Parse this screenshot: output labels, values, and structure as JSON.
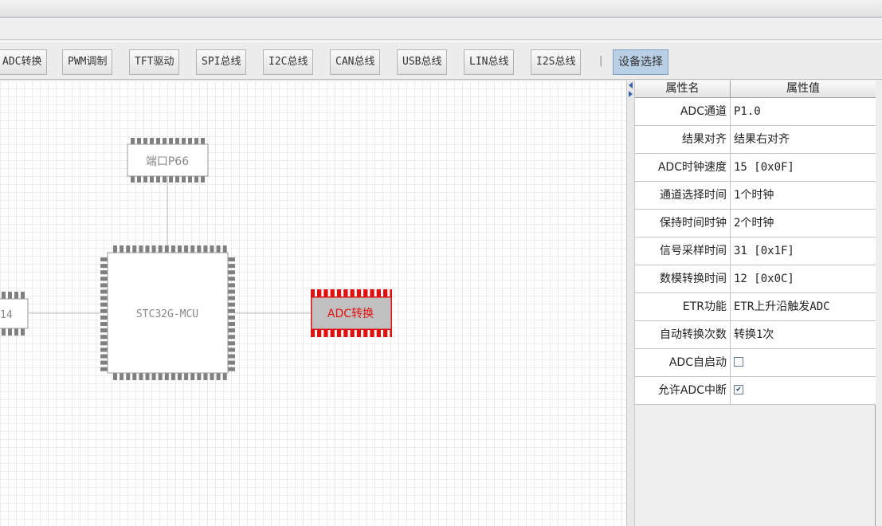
{
  "toolbar": {
    "buttons": [
      "ADC转换",
      "PWM调制",
      "TFT驱动",
      "SPI总线",
      "I2C总线",
      "CAN总线",
      "USB总线",
      "LIN总线",
      "I2S总线"
    ],
    "separator": "|",
    "active_button": "设备选择"
  },
  "canvas": {
    "port_chip": "端口P66",
    "mcu_chip": "STC32G-MCU",
    "adc_chip": "ADC转换",
    "left_chip_partial": "14"
  },
  "properties": {
    "header_name": "属性名",
    "header_value": "属性值",
    "rows": [
      {
        "name": "ADC通道",
        "value": "P1.0"
      },
      {
        "name": "结果对齐",
        "value": "结果右对齐"
      },
      {
        "name": "ADC时钟速度",
        "value": "15 [0x0F]"
      },
      {
        "name": "通道选择时间",
        "value": "1个时钟"
      },
      {
        "name": "保持时间时钟",
        "value": "2个时钟"
      },
      {
        "name": "信号采样时间",
        "value": "31 [0x1F]"
      },
      {
        "name": "数模转换时间",
        "value": "12 [0x0C]"
      },
      {
        "name": "ETR功能",
        "value": "ETR上升沿触发ADC"
      },
      {
        "name": "自动转换次数",
        "value": "转换1次"
      },
      {
        "name": "ADC自启动",
        "checked": false
      },
      {
        "name": "允许ADC中断",
        "checked": true
      }
    ]
  },
  "colors": {
    "selected_chip": "#e01010",
    "chip_pins": "#808080",
    "active_tab": "#b8cfe5"
  }
}
